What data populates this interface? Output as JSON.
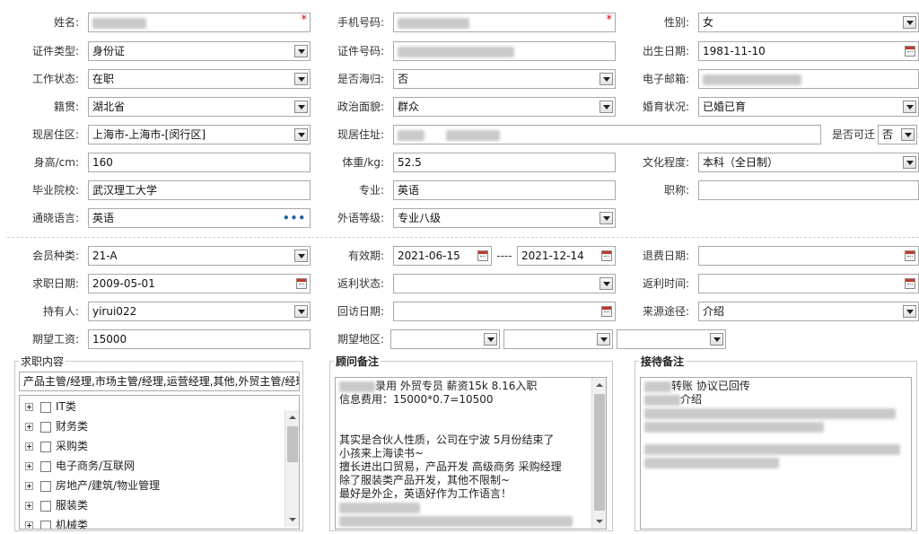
{
  "form": {
    "name": {
      "label": "姓名:",
      "value": ""
    },
    "phone": {
      "label": "手机号码:",
      "value": ""
    },
    "gender": {
      "label": "性别:",
      "value": "女"
    },
    "id_type": {
      "label": "证件类型:",
      "value": "身份证"
    },
    "id_no": {
      "label": "证件号码:",
      "value": ""
    },
    "birth": {
      "label": "出生日期:",
      "value": "1981-11-10"
    },
    "work_status": {
      "label": "工作状态:",
      "value": "在职"
    },
    "returnee": {
      "label": "是否海归:",
      "value": "否"
    },
    "email": {
      "label": "电子邮箱:",
      "value": ""
    },
    "native": {
      "label": "籍贯:",
      "value": "湖北省"
    },
    "political": {
      "label": "政治面貌:",
      "value": "群众"
    },
    "marital": {
      "label": "婚育状况:",
      "value": "已婚已育"
    },
    "residence": {
      "label": "现居住区:",
      "value": "上海市-上海市-[闵行区]"
    },
    "address": {
      "label": "现居住址:",
      "value": ""
    },
    "relocate": {
      "label": "是否可迁",
      "value": "否"
    },
    "height": {
      "label": "身高/cm:",
      "value": "160"
    },
    "weight": {
      "label": "体重/kg:",
      "value": "52.5"
    },
    "education": {
      "label": "文化程度:",
      "value": "本科（全日制）"
    },
    "school": {
      "label": "毕业院校:",
      "value": "武汉理工大学"
    },
    "major": {
      "label": "专业:",
      "value": "英语"
    },
    "title": {
      "label": "职称:",
      "value": ""
    },
    "language": {
      "label": "通晓语言:",
      "value": "英语"
    },
    "lang_level": {
      "label": "外语等级:",
      "value": "专业八级"
    }
  },
  "member": {
    "type": {
      "label": "会员种类:",
      "value": "21-A"
    },
    "validity": {
      "label": "有效期:",
      "start": "2021-06-15",
      "sep": "----",
      "end": "2021-12-14"
    },
    "refund_date": {
      "label": "退费日期:",
      "value": ""
    },
    "job_date": {
      "label": "求职日期:",
      "value": "2009-05-01"
    },
    "rebate_status": {
      "label": "返利状态:",
      "value": ""
    },
    "rebate_time": {
      "label": "返利时间:",
      "value": ""
    },
    "holder": {
      "label": "持有人:",
      "value": "yirui022"
    },
    "visit_date": {
      "label": "回访日期:",
      "value": ""
    },
    "source": {
      "label": "来源途径:",
      "value": "介绍"
    },
    "salary": {
      "label": "期望工资:",
      "value": "15000"
    },
    "area": {
      "label": "期望地区:",
      "v1": "",
      "v2": "",
      "v3": ""
    }
  },
  "job_content": {
    "legend": "求职内容",
    "summary": "产品主管/经理,市场主管/经理,运营经理,其他,外贸主管/经理",
    "tree": [
      "IT类",
      "财务类",
      "采购类",
      "电子商务/互联网",
      "房地产/建筑/物业管理",
      "服装类",
      "机械类"
    ]
  },
  "advisor_notes": {
    "legend": "顾问备注",
    "lines": [
      "录用 外贸专员 薪资15k   8.16入职",
      "信息费用：15000*0.7=10500",
      "",
      "",
      "其实是合伙人性质，公司在宁波  5月份结束了",
      "小孩来上海读书~",
      "擅长进出口贸易，产品开发 高级商务 采购经理",
      "除了服装类产品开发，其他不限制~",
      "最好是外企，英语好作为工作语言！"
    ]
  },
  "reception_notes": {
    "legend": "接待备注",
    "lines": [
      "转账 协议已回传",
      "介绍"
    ]
  },
  "colors": {
    "required": "#d40000",
    "border": "#a9a9a9",
    "calendar": "#c0392b"
  }
}
